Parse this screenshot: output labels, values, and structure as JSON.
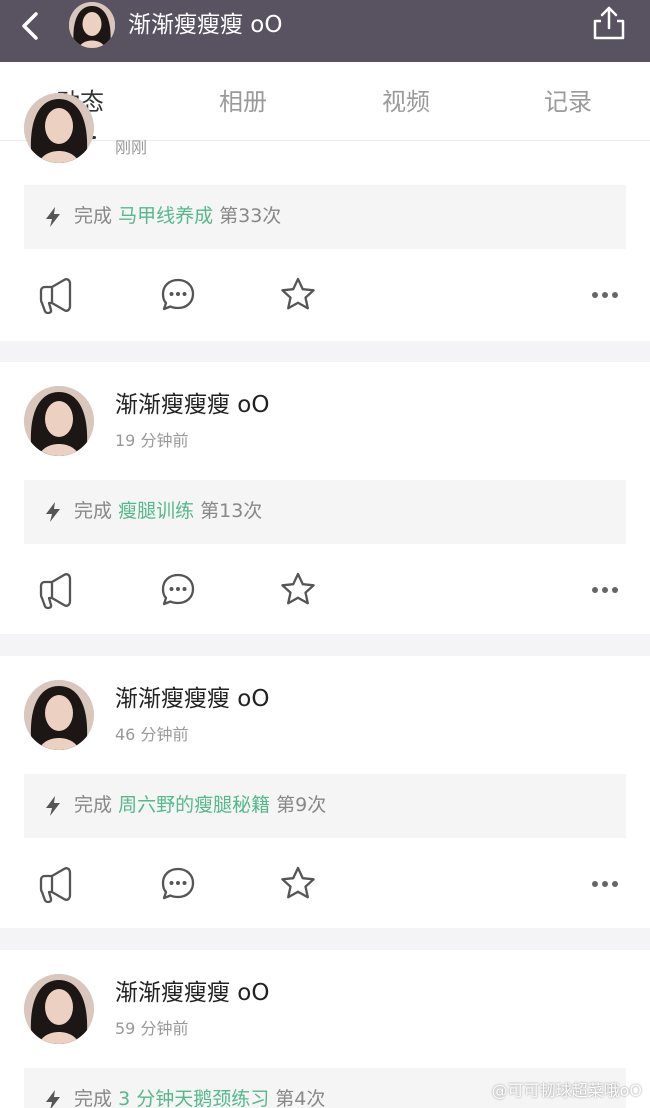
{
  "header": {
    "title": "渐渐瘦瘦瘦 oO",
    "back_icon": "chevron-left-icon",
    "share_icon": "share-icon"
  },
  "tabs": [
    {
      "label": "动态",
      "active": true
    },
    {
      "label": "相册",
      "active": false
    },
    {
      "label": "视频",
      "active": false
    },
    {
      "label": "记录",
      "active": false
    }
  ],
  "posts": [
    {
      "name": "",
      "time": "刚刚",
      "task_prefix": "完成",
      "task_name": "马甲线养成",
      "task_count": "第33次"
    },
    {
      "name": "渐渐瘦瘦瘦 oO",
      "time": "19 分钟前",
      "task_prefix": "完成",
      "task_name": "瘦腿训练",
      "task_count": "第13次"
    },
    {
      "name": "渐渐瘦瘦瘦 oO",
      "time": "46 分钟前",
      "task_prefix": "完成",
      "task_name": "周六野的瘦腿秘籍",
      "task_count": "第9次"
    },
    {
      "name": "渐渐瘦瘦瘦 oO",
      "time": "59 分钟前",
      "task_prefix": "完成",
      "task_name": "3 分钟天鹅颈练习",
      "task_count": "第4次"
    }
  ],
  "actions": [
    "megaphone-icon",
    "comment-icon",
    "star-icon",
    "more-icon"
  ],
  "watermark": "@可可韧球超菜哦oO",
  "colors": {
    "header_bg": "#595261",
    "accent_green": "#55b98d",
    "page_bg": "#f4f4f6"
  }
}
